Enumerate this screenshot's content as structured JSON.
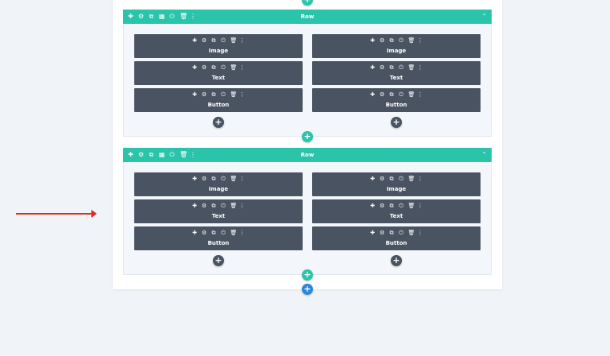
{
  "icons": {
    "move": "✚",
    "settings": "⚙",
    "duplicate": "⧉",
    "columns": "▦",
    "power": "⏻",
    "trash": "🗑",
    "more": "⋮",
    "collapse": "⌃",
    "add": "+"
  },
  "rows": [
    {
      "label": "Row",
      "columns": [
        {
          "modules": [
            {
              "label": "Image"
            },
            {
              "label": "Text"
            },
            {
              "label": "Button"
            }
          ]
        },
        {
          "modules": [
            {
              "label": "Image"
            },
            {
              "label": "Text"
            },
            {
              "label": "Button"
            }
          ]
        }
      ]
    },
    {
      "label": "Row",
      "columns": [
        {
          "modules": [
            {
              "label": "Image"
            },
            {
              "label": "Text"
            },
            {
              "label": "Button"
            }
          ]
        },
        {
          "modules": [
            {
              "label": "Image"
            },
            {
              "label": "Text"
            },
            {
              "label": "Button"
            }
          ]
        }
      ]
    }
  ],
  "colors": {
    "row_bar": "#29c4a9",
    "module": "#4a5361",
    "add_section": "#2b87da",
    "arrow": "#e02b20",
    "background": "#f0f3f8"
  }
}
